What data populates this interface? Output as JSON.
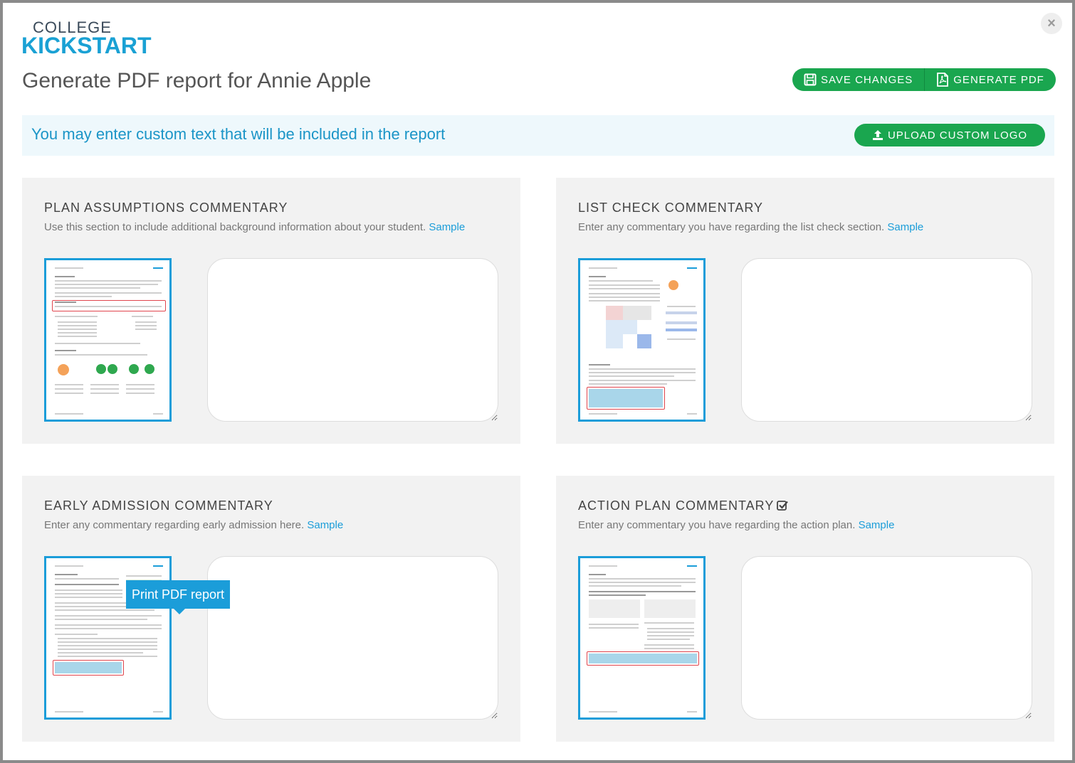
{
  "brand": {
    "line1": "COLLEGE",
    "line2": "KICKSTART"
  },
  "header": {
    "title": "Generate PDF report for Annie Apple",
    "save_label": "SAVE CHANGES",
    "generate_label": "GENERATE PDF",
    "close_label": "×"
  },
  "notice": {
    "text": "You may enter custom text that will be included in the report",
    "upload_label": "UPLOAD CUSTOM LOGO"
  },
  "sections": [
    {
      "title": "PLAN ASSUMPTIONS COMMENTARY",
      "desc": "Use this section to include additional background information about your student.",
      "sample": "Sample",
      "text": ""
    },
    {
      "title": "LIST CHECK COMMENTARY",
      "desc": "Enter any commentary you have regarding the list check section.",
      "sample": "Sample",
      "text": ""
    },
    {
      "title": "EARLY ADMISSION COMMENTARY",
      "desc": "Enter any commentary regarding early admission here.",
      "sample": "Sample",
      "text": ""
    },
    {
      "title": "ACTION PLAN COMMENTARY",
      "desc": "Enter any commentary you have regarding the action plan.",
      "sample": "Sample",
      "text": "",
      "checked": true
    }
  ],
  "tooltip": {
    "text": "Print PDF report"
  },
  "colors": {
    "accent_green": "#1aa64f",
    "accent_blue": "#1b9dd9",
    "highlight_red": "#e0454d"
  }
}
